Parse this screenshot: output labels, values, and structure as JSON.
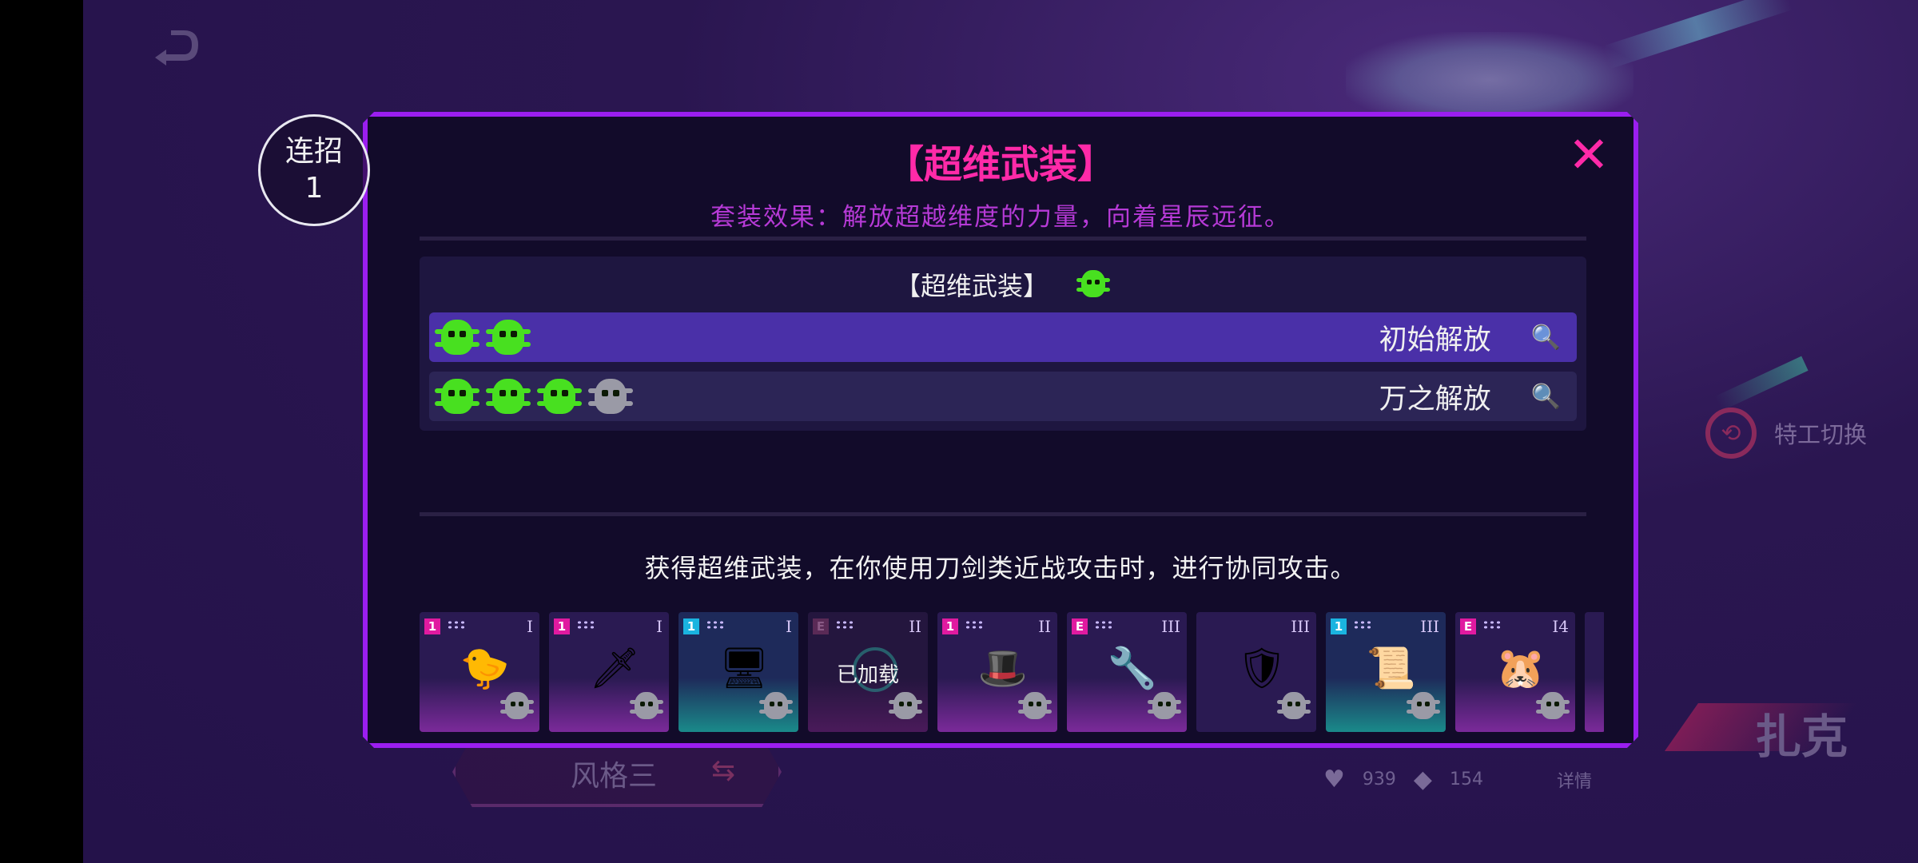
{
  "background": {
    "agent_switch_label": "特工切换",
    "character_name": "扎克",
    "style_label": "风格三",
    "stats": {
      "hp": "939",
      "armor": "154",
      "detail_label": "详情"
    }
  },
  "combo": {
    "label": "连招",
    "count": "1"
  },
  "modal": {
    "title": "【超维武装】",
    "close_glyph": "✕",
    "effect_text": "套装效果：解放超越维度的力量，向着星辰远征。",
    "set_header": "【超维武装】",
    "tiers": [
      {
        "name": "初始解放",
        "active": true,
        "green_icons": 2,
        "grey_icons": 0
      },
      {
        "name": "万之解放",
        "active": false,
        "green_icons": 3,
        "grey_icons": 1
      }
    ],
    "search_icon": "search-icon",
    "description": "获得超维武装，在你使用刀剑类近战攻击时，进行协同攻击。",
    "cards": [
      {
        "level": "1",
        "rank": "I",
        "item": "rubber-duck",
        "glyph": "🐤",
        "style": "pink"
      },
      {
        "level": "1",
        "rank": "I",
        "item": "sword",
        "glyph": "🗡",
        "style": "pink"
      },
      {
        "level": "1",
        "rank": "I",
        "item": "monitor",
        "glyph": "🖥",
        "style": "cyan"
      },
      {
        "level": "E",
        "rank": "II",
        "item": "loaded",
        "loaded_label": "已加载",
        "style": "dim"
      },
      {
        "level": "1",
        "rank": "II",
        "item": "hat",
        "glyph": "🎩",
        "style": "pink"
      },
      {
        "level": "E",
        "rank": "III",
        "item": "wrench",
        "glyph": "🔧",
        "style": "pink"
      },
      {
        "level": "",
        "rank": "III",
        "item": "bug-shield",
        "glyph": "🛡",
        "style": "dark"
      },
      {
        "level": "1",
        "rank": "III",
        "item": "scroll",
        "glyph": "📜",
        "style": "cyan"
      },
      {
        "level": "E",
        "rank": "I4",
        "item": "hamster",
        "glyph": "🐹",
        "style": "pink"
      }
    ]
  },
  "colors": {
    "accent_pink": "#ff2aa8",
    "border_purple": "#9b1ef0",
    "active_row": "#4a30a8",
    "set_green": "#48e020"
  }
}
